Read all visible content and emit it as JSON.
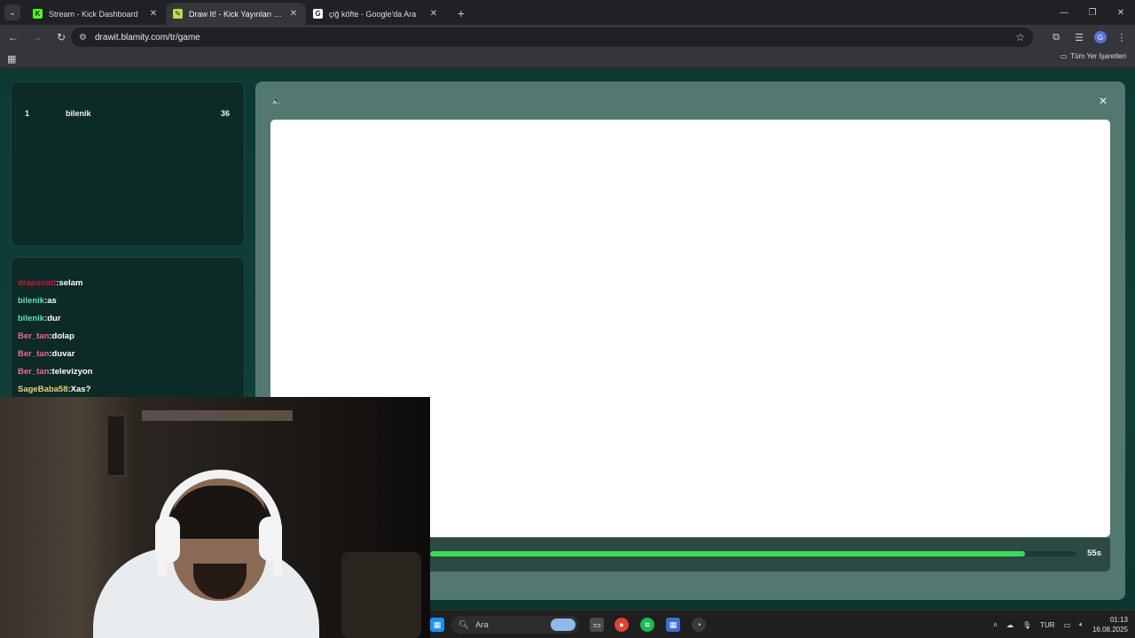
{
  "browser": {
    "tabs": [
      {
        "title": "Stream - Kick Dashboard",
        "active": false,
        "favicon_color": "#53fc18",
        "favicon": "K"
      },
      {
        "title": "Draw It! - Kick Yayınları İçin Çizim",
        "active": true,
        "favicon_color": "#b8e04a",
        "favicon": "✎"
      },
      {
        "title": "çiğ köfte - Google'da Ara",
        "active": false,
        "favicon_color": "#ffffff",
        "favicon": "G"
      }
    ],
    "url": "drawit.blamity.com/tr/game",
    "bookmarks_label": "Tüm Yer İşaretleri",
    "profile_initial": "G"
  },
  "leaderboard": {
    "rows": [
      {
        "rank": "1",
        "name": "bilenik",
        "score": "36"
      }
    ]
  },
  "chat": {
    "messages": [
      {
        "user": "drapsnatt",
        "text": ":selam",
        "color": "#c8163c"
      },
      {
        "user": "bilenik",
        "text": ":as",
        "color": "#5fe0c0"
      },
      {
        "user": "bilenik",
        "text": ":dur",
        "color": "#5fe0c0"
      },
      {
        "user": "Ber_tan",
        "text": ":dolap",
        "color": "#f06a8c"
      },
      {
        "user": "Ber_tan",
        "text": ":duvar",
        "color": "#f06a8c"
      },
      {
        "user": "Ber_tan",
        "text": ":televizyon",
        "color": "#f06a8c"
      },
      {
        "user": "SageBaba58",
        "text": ":Xas?",
        "color": "#e7d27a"
      }
    ]
  },
  "game": {
    "timer_label": "55s",
    "timer_progress": 0.92
  },
  "taskbar": {
    "search_placeholder": "Ara",
    "language": "TUR",
    "time": "01:13",
    "date": "16.08.2025"
  },
  "colors": {
    "accent_green": "#35dd57",
    "panel": "#53786f"
  }
}
